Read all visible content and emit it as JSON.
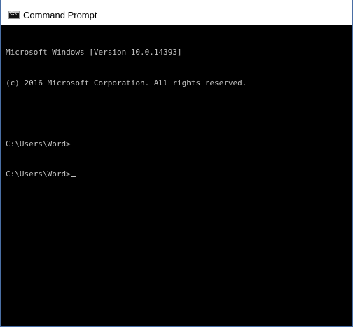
{
  "window": {
    "title": "Command Prompt",
    "icon": "cmd-icon"
  },
  "console": {
    "lines": [
      "Microsoft Windows [Version 10.0.14393]",
      "(c) 2016 Microsoft Corporation. All rights reserved.",
      "",
      "C:\\Users\\Word>",
      "C:\\Users\\Word>"
    ],
    "text_color": "#c0c0c0",
    "background_color": "#000000"
  }
}
